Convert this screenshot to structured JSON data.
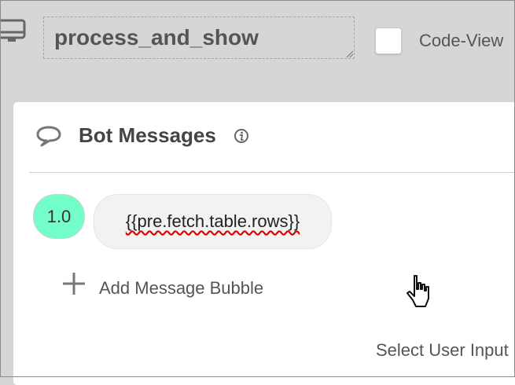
{
  "header": {
    "node_icon": "monitor-icon",
    "node_name": "process_and_show",
    "code_view_label": "Code-View",
    "code_view_checked": false
  },
  "panel": {
    "icon": "speech-bubble-icon",
    "title": "Bot Messages",
    "info_icon": "info-icon",
    "messages": [
      {
        "version": "1.0",
        "text": "{{pre.fetch.table.rows}}"
      }
    ],
    "add_label": "Add Message Bubble",
    "select_user_input_label": "Select User Input"
  },
  "colors": {
    "background": "#d6d6d6",
    "panel": "#ffffff",
    "version_badge": "#73fdc9",
    "bubble": "#f2f2f2",
    "spellcheck": "#dd0000"
  }
}
